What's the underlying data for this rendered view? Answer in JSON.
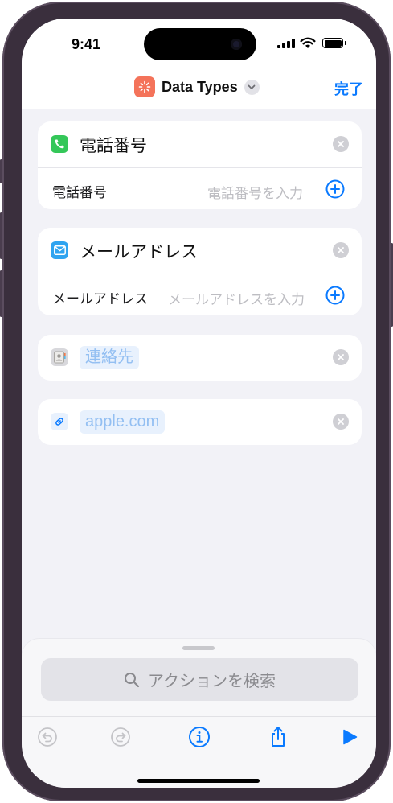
{
  "status": {
    "time": "9:41"
  },
  "nav": {
    "title": "Data Types",
    "done_label": "完了"
  },
  "cards": {
    "phone": {
      "title": "電話番号",
      "field_label": "電話番号",
      "placeholder": "電話番号を入力"
    },
    "email": {
      "title": "メールアドレス",
      "field_label": "メールアドレス",
      "placeholder": "メールアドレスを入力"
    },
    "contact": {
      "token": "連絡先"
    },
    "url": {
      "token": "apple.com"
    }
  },
  "sheet": {
    "search_placeholder": "アクションを検索"
  },
  "icons": {
    "app": "shortcuts-icon",
    "phone": "phone-icon",
    "email": "envelope-icon",
    "contact": "contacts-icon",
    "link": "link-icon",
    "undo": "undo-icon",
    "redo": "redo-icon",
    "info": "info-icon",
    "share": "share-icon",
    "run": "play-icon"
  },
  "colors": {
    "accent": "#0a7aff",
    "phone_icon_bg": "#34c759",
    "mail_icon_bg": "#2fa4f0",
    "app_icon_bg": "#f4735a",
    "token_bg": "#e8f1fd",
    "token_text": "#93bff2"
  }
}
